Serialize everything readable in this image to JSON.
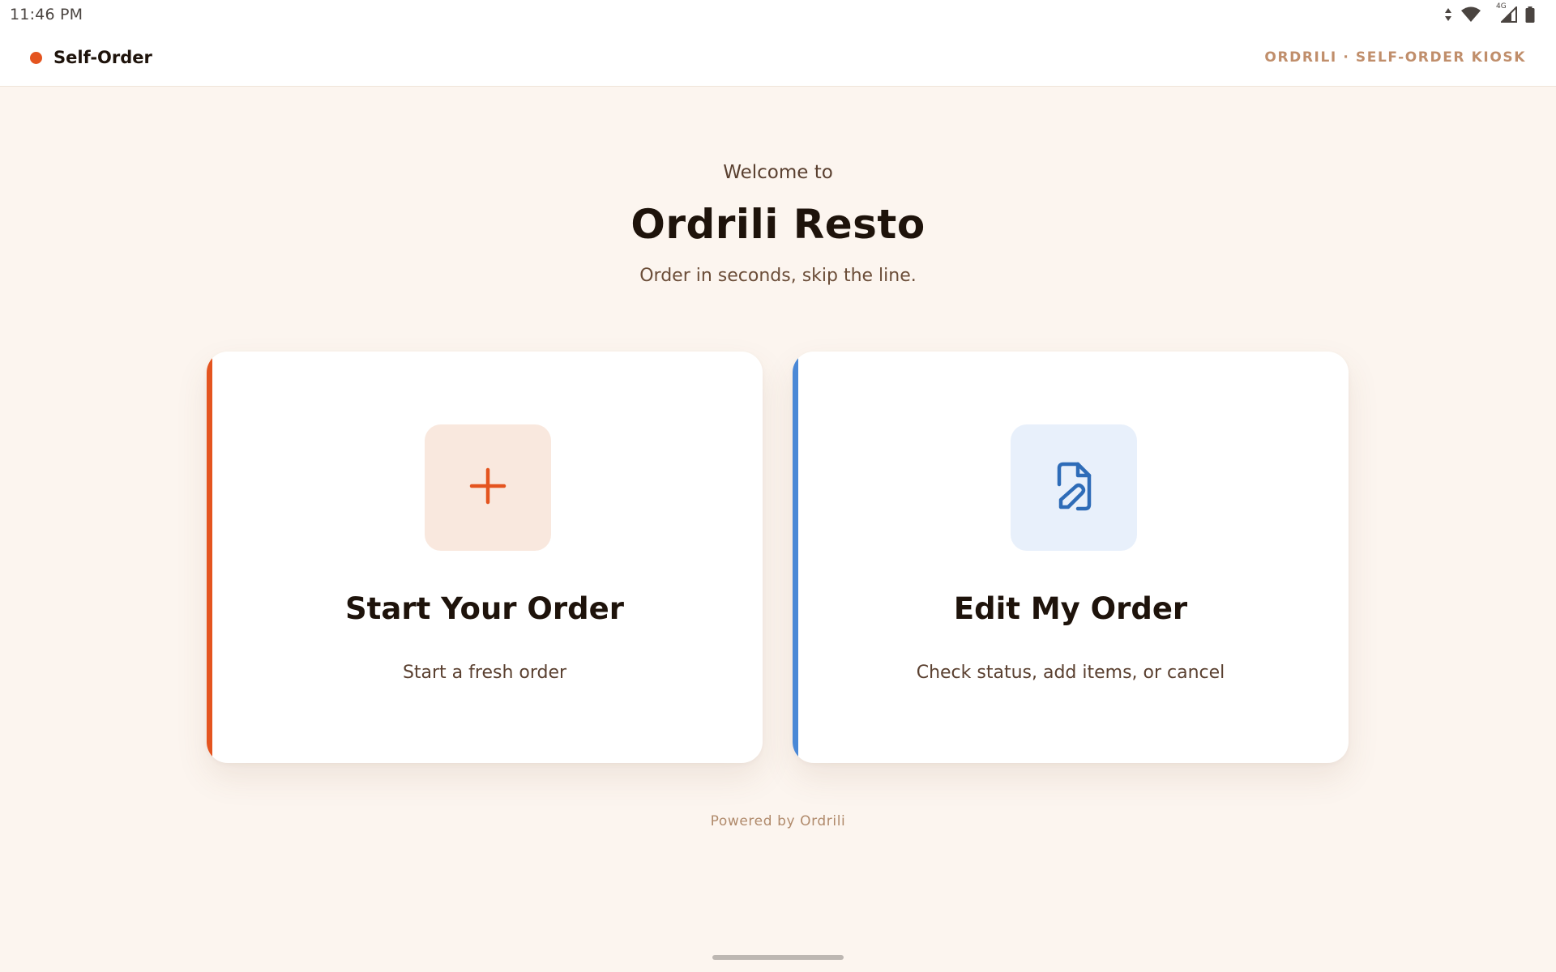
{
  "status_bar": {
    "time": "11:46 PM",
    "network_label": "4G"
  },
  "header": {
    "brand_label": "Self-Order",
    "kiosk_label": "ORDRILI · SELF-ORDER KIOSK"
  },
  "hero": {
    "welcome": "Welcome to",
    "restaurant_name": "Ordrili Resto",
    "tagline": "Order in seconds, skip the line."
  },
  "cards": [
    {
      "title": "Start Your Order",
      "subtitle": "Start a fresh order",
      "icon": "plus-icon",
      "accent_color": "#e4541f"
    },
    {
      "title": "Edit My Order",
      "subtitle": "Check status, add items, or cancel",
      "icon": "file-edit-icon",
      "accent_color": "#4a88d6"
    }
  ],
  "footer": {
    "powered_by": "Powered by Ordrili"
  },
  "colors": {
    "background": "#fcf5ef",
    "brand": "#e4541f",
    "secondary": "#4a88d6",
    "muted_text": "#c08e6b"
  }
}
